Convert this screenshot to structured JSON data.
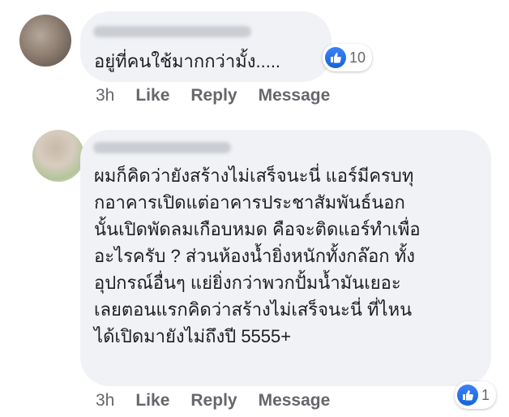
{
  "comments": [
    {
      "text": "อยู่ที่คนใช้มากกว่ามั้ง.....",
      "time": "3h",
      "actions": [
        "Like",
        "Reply",
        "Message"
      ],
      "reaction_count": "10",
      "reaction_icon": "like-icon"
    },
    {
      "text_lines": [
        "ผมก็คิดว่ายังสร้างไม่เสร็จนะนี่ แอร์มีครบทุ",
        "กอาคารเปิดแต่อาคารประชาสัมพันธ์นอก",
        "นั้นเปิดพัดลมเกือบหมด คือจะติดแอร์ทำเพื่อ",
        "อะไรครับ ? ส่วนห้องน้ำยิ่งหนักทั้งกล๊อก ทั้ง",
        "อุปกรณ์อื่นๆ แย่ยิ่งกว่าพวกปั้มน้ำมันเยอะ",
        "เลยตอนแรกคิดว่าสร้างไม่เสร็จนะนี่ ที่ไหน",
        "ได้เปิดมายังไม่ถึงปี 5555+"
      ],
      "time": "3h",
      "actions": [
        "Like",
        "Reply",
        "Message"
      ],
      "reaction_count": "1",
      "reaction_icon": "like-icon"
    }
  ],
  "colors": {
    "bubble": "#f0f2f5",
    "meta_text": "#65676b",
    "like_blue": "#1877f2"
  }
}
